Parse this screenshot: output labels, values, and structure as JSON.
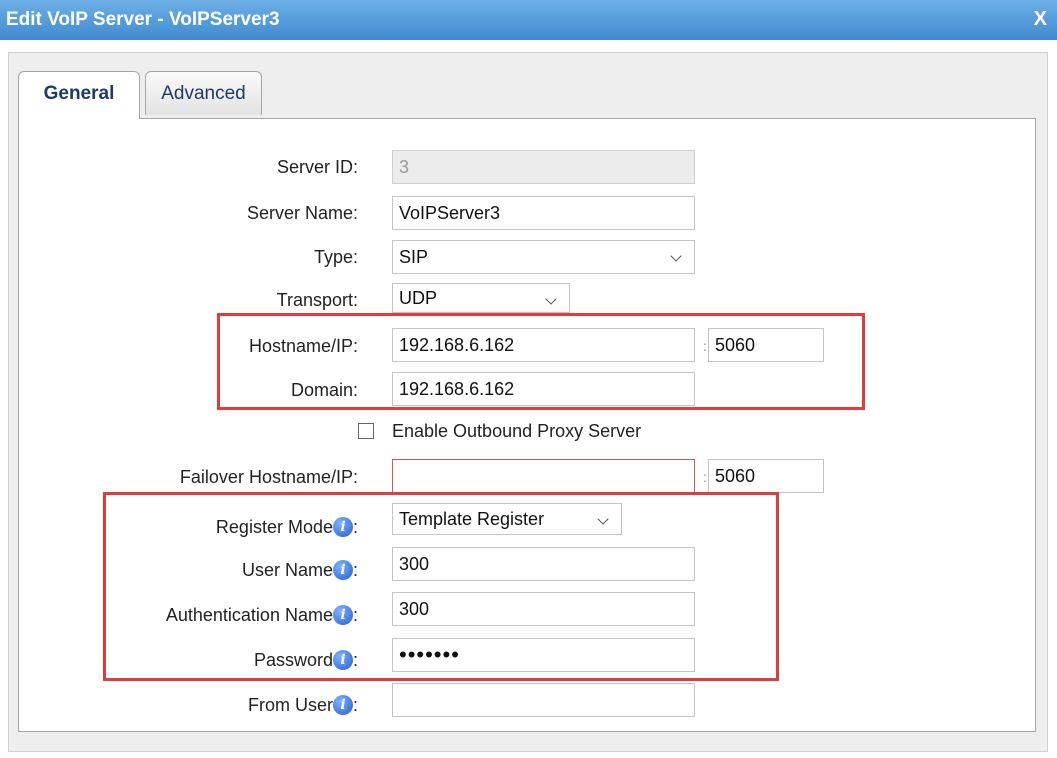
{
  "dialog": {
    "title": "Edit VoIP Server - VoIPServer3",
    "close_label": "X"
  },
  "tabs": [
    {
      "label": "General",
      "active": true
    },
    {
      "label": "Advanced",
      "active": false
    }
  ],
  "form": {
    "server_id": {
      "label": "Server ID:",
      "value": "3"
    },
    "server_name": {
      "label": "Server Name:",
      "value": "VoIPServer3"
    },
    "type": {
      "label": "Type:",
      "value": "SIP"
    },
    "transport": {
      "label": "Transport:",
      "value": "UDP"
    },
    "hostname": {
      "label": "Hostname/IP:",
      "value": "192.168.6.162",
      "port": "5060"
    },
    "domain": {
      "label": "Domain:",
      "value": "192.168.6.162"
    },
    "outbound_proxy": {
      "label": "Enable Outbound Proxy Server",
      "checked": false
    },
    "failover": {
      "label": "Failover Hostname/IP:",
      "value": "",
      "port": "5060"
    },
    "register_mode": {
      "label": "Register Mode",
      "value": "Template Register"
    },
    "user_name": {
      "label": "User Name",
      "value": "300"
    },
    "auth_name": {
      "label": "Authentication Name",
      "value": "300"
    },
    "password": {
      "label": "Password",
      "value": "•••••••"
    },
    "from_user": {
      "label": "From User",
      "value": ""
    }
  },
  "colors": {
    "titlebar": "#4a95d8",
    "highlight": "#e03c3c",
    "info_icon": "#1f5fcf"
  },
  "icons": {
    "info": "info-icon",
    "dropdown": "chevron-down-icon"
  }
}
